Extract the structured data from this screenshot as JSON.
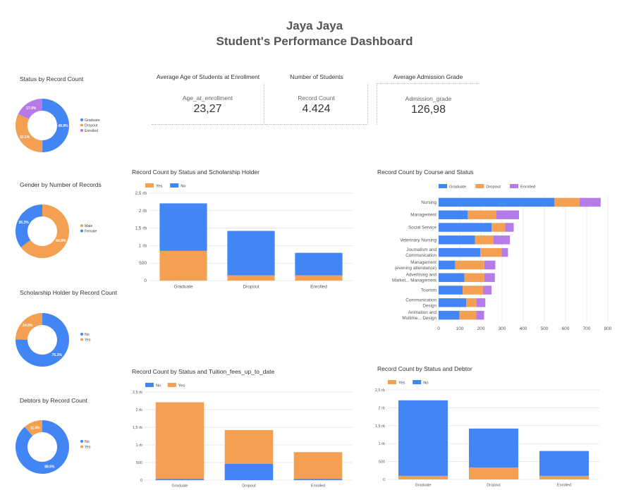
{
  "header": {
    "line1": "Jaya Jaya",
    "line2": "Student's Performance Dashboard"
  },
  "colors": {
    "blue": "#4285f4",
    "orange": "#f4a052",
    "purple": "#b57be8",
    "grid": "#e0e0e0"
  },
  "kpis": [
    {
      "title": "Average Age of Students at Enrollment",
      "metric": "Age_at_enrollment",
      "value": "23,27"
    },
    {
      "title": "Number of Students",
      "metric": "Record Count",
      "value": "4.424"
    },
    {
      "title": "Average Admission Grade",
      "metric": "Admission_grade",
      "value": "126,98"
    }
  ],
  "chart_data": [
    {
      "id": "status",
      "type": "pie",
      "title": "Status by Record Count",
      "labels": [
        "Graduate",
        "Dropout",
        "Enrolled"
      ],
      "values": [
        49.9,
        32.1,
        17.9
      ],
      "value_labels": [
        "49.9%",
        "32.1%",
        "17.9%"
      ],
      "colors": [
        "#4285f4",
        "#f4a052",
        "#b57be8"
      ],
      "legend": "right"
    },
    {
      "id": "gender",
      "type": "pie",
      "title": "Gender by Number of Records",
      "labels": [
        "Male",
        "Female"
      ],
      "values": [
        64.8,
        35.2
      ],
      "value_labels": [
        "64.8%",
        "35.2%"
      ],
      "colors": [
        "#f4a052",
        "#4285f4"
      ],
      "legend": "right"
    },
    {
      "id": "scholar",
      "type": "pie",
      "title": "Scholarship Holder by Record Count",
      "labels": [
        "No",
        "Yes"
      ],
      "values": [
        75.2,
        24.8
      ],
      "value_labels": [
        "75.2%",
        "24.8%"
      ],
      "colors": [
        "#4285f4",
        "#f4a052"
      ],
      "legend": "right"
    },
    {
      "id": "debtor",
      "type": "pie",
      "title": "Debtors by Record Count",
      "labels": [
        "No",
        "Yes"
      ],
      "values": [
        88.6,
        11.4
      ],
      "value_labels": [
        "88.6%",
        "11.4%"
      ],
      "colors": [
        "#4285f4",
        "#f4a052"
      ],
      "legend": "right"
    },
    {
      "id": "scholar_bar",
      "type": "bar",
      "stacked": true,
      "title": "Record Count by Status and Scholarship Holder",
      "categories": [
        "Graduate",
        "Dropout",
        "Enrolled"
      ],
      "series": [
        {
          "name": "Yes",
          "color": "#f4a052",
          "values": [
            850,
            150,
            150
          ]
        },
        {
          "name": "No",
          "color": "#4285f4",
          "values": [
            1359,
            1271,
            644
          ]
        }
      ],
      "ylim": [
        0,
        2500
      ],
      "yticks": [
        "0",
        "500",
        "1 rb",
        "1,5 rb",
        "2 rb",
        "2,5 rb"
      ],
      "legend": "top-left",
      "grid": true
    },
    {
      "id": "course_bar",
      "type": "bar",
      "orientation": "horizontal",
      "stacked": true,
      "title": "Record Count by Course and Status",
      "categories": [
        "Nursing",
        "Management",
        "Social Service",
        "Veterinary Nursing",
        "Journalism and Communication",
        "Management (evening attendance)",
        "Advertising and Market... Management",
        "Tourism",
        "Communication Design",
        "Animation and Multime... Design"
      ],
      "series": [
        {
          "name": "Graduate",
          "color": "#4285f4",
          "values": [
            548,
            138,
            250,
            172,
            197,
            78,
            122,
            114,
            130,
            98
          ]
        },
        {
          "name": "Dropout",
          "color": "#f4a052",
          "values": [
            118,
            135,
            65,
            88,
            101,
            138,
            94,
            96,
            50,
            80
          ]
        },
        {
          "name": "Enrolled",
          "color": "#b57be8",
          "values": [
            100,
            107,
            40,
            77,
            30,
            52,
            50,
            40,
            41,
            37
          ]
        }
      ],
      "xlim": [
        0,
        800
      ],
      "xticks": [
        "0",
        "100",
        "200",
        "300",
        "400",
        "500",
        "600",
        "700",
        "800"
      ],
      "legend": "top-left",
      "grid": true
    },
    {
      "id": "tuition_bar",
      "type": "bar",
      "stacked": true,
      "title": "Record Count by Status and Tuition_fees_up_to_date",
      "categories": [
        "Graduate",
        "Dropout",
        "Enrolled"
      ],
      "series": [
        {
          "name": "No",
          "color": "#4285f4",
          "values": [
            30,
            460,
            30
          ]
        },
        {
          "name": "Yes",
          "color": "#f4a052",
          "values": [
            2179,
            961,
            764
          ]
        }
      ],
      "ylim": [
        0,
        2500
      ],
      "yticks": [
        "0",
        "500",
        "1 rb",
        "1,5 rb",
        "2 rb",
        "2,5 rb"
      ],
      "legend": "top-left",
      "grid": true
    },
    {
      "id": "debtor_bar",
      "type": "bar",
      "stacked": true,
      "title": "Record Count by Status and Debtor",
      "categories": [
        "Graduate",
        "Dropout",
        "Enrolled"
      ],
      "series": [
        {
          "name": "Yes",
          "color": "#f4a052",
          "values": [
            100,
            330,
            100
          ]
        },
        {
          "name": "No",
          "color": "#4285f4",
          "values": [
            2109,
            1091,
            694
          ]
        }
      ],
      "ylim": [
        0,
        2500
      ],
      "yticks": [
        "0",
        "500",
        "1 rb",
        "1,5 rb",
        "2 rb",
        "2,5 rb"
      ],
      "legend": "top-left",
      "grid": true
    }
  ]
}
